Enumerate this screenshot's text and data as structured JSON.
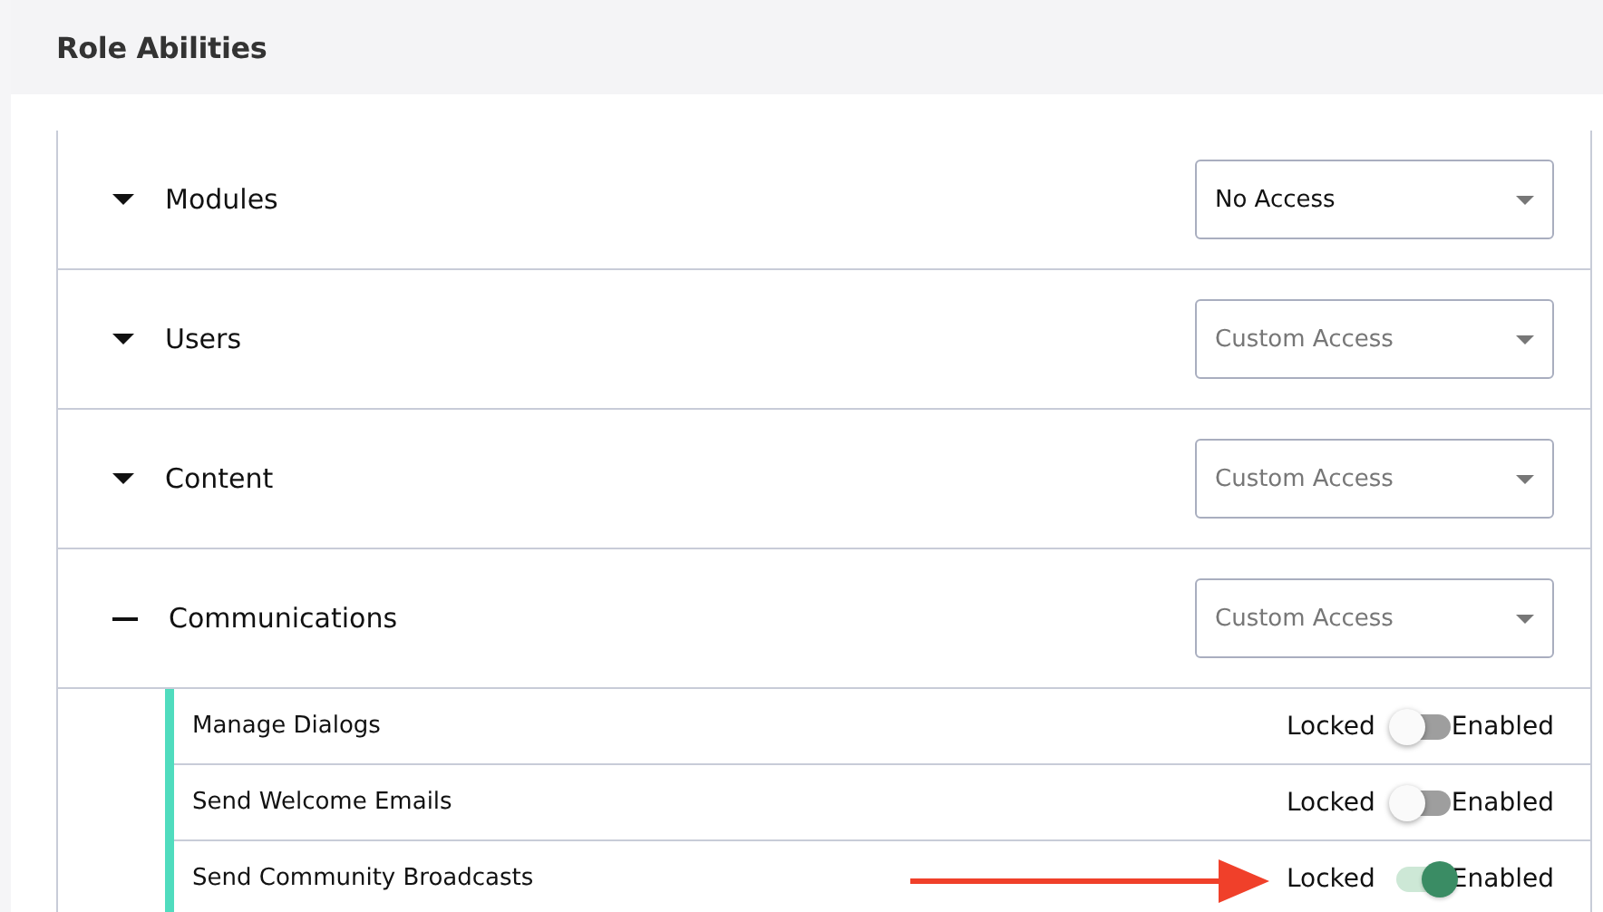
{
  "panel": {
    "title": "Role Abilities"
  },
  "categories": [
    {
      "name": "Modules",
      "expanded": false,
      "access": {
        "value": "No Access"
      }
    },
    {
      "name": "Users",
      "expanded": false,
      "access": {
        "placeholder": "Custom Access"
      }
    },
    {
      "name": "Content",
      "expanded": false,
      "access": {
        "placeholder": "Custom Access"
      }
    },
    {
      "name": "Communications",
      "expanded": true,
      "access": {
        "placeholder": "Custom Access"
      },
      "abilities": [
        {
          "name": "Manage Dialogs",
          "off_label": "Locked",
          "on_label": "Enabled",
          "on": false
        },
        {
          "name": "Send Welcome Emails",
          "off_label": "Locked",
          "on_label": "Enabled",
          "on": false
        },
        {
          "name": "Send Community Broadcasts",
          "off_label": "Locked",
          "on_label": "Enabled",
          "on": true
        }
      ]
    }
  ]
}
